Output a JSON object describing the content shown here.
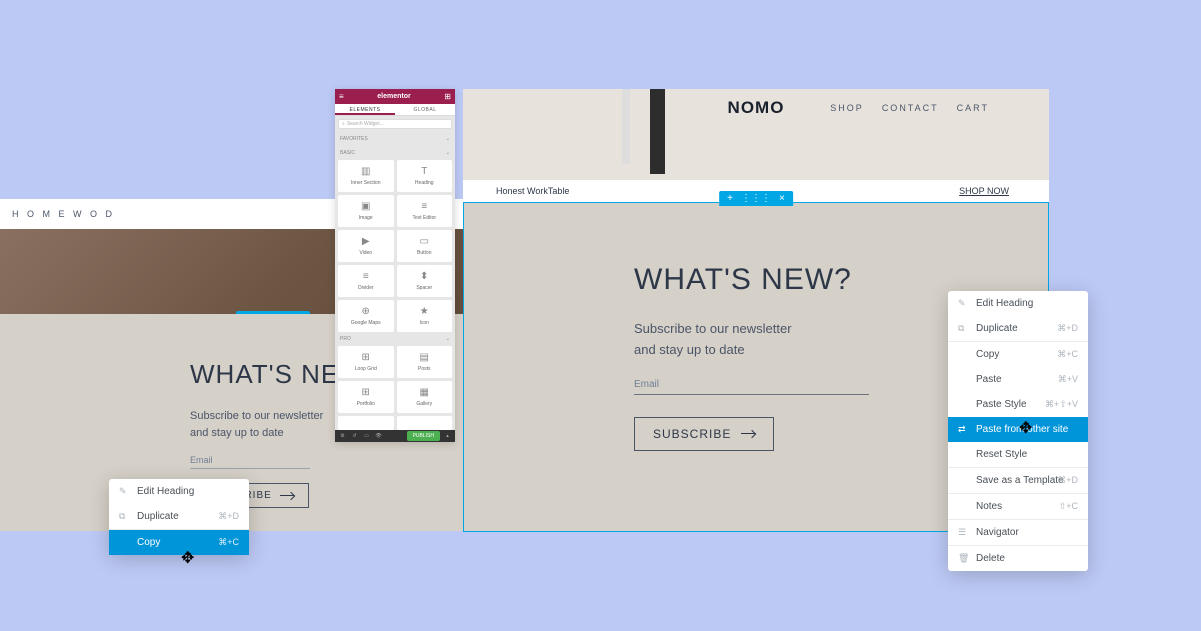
{
  "site_left": {
    "logo": "H O M E W O D",
    "heading": "WHAT'S NEW?",
    "sub_line1": "Subscribe to our newsletter",
    "sub_line2": "and stay up to date",
    "email_label": "Email",
    "subscribe_btn": "SUBSCRIBE"
  },
  "site_right": {
    "logo": "NOMO",
    "nav": {
      "shop": "SHOP",
      "contact": "CONTACT",
      "cart": "CART"
    },
    "product": "Honest WorkTable",
    "shop_now": "SHOP NOW",
    "heading": "WHAT'S NEW?",
    "sub_line1": "Subscribe to our newsletter",
    "sub_line2": "and stay up to date",
    "email_label": "Email",
    "subscribe_btn": "SUBSCRIBE"
  },
  "elementor": {
    "brand": "elementor",
    "tabs": {
      "elements": "ELEMENTS",
      "global": "GLOBAL"
    },
    "search_placeholder": "Search Widget...",
    "cat_favorites": "FAVORITES",
    "cat_basic": "BASIC",
    "cat_pro": "PRO",
    "widgets": {
      "inner_section": "Inner Section",
      "heading": "Heading",
      "image": "Image",
      "text_editor": "Text Editor",
      "video": "Video",
      "button": "Button",
      "divider": "Divider",
      "spacer": "Spacer",
      "google_maps": "Google Maps",
      "icon": "Icon",
      "loop_grid": "Loop Grid",
      "posts": "Posts",
      "portfolio": "Portfolio",
      "gallery": "Gallery"
    },
    "publish": "PUBLISH"
  },
  "ctx_left": {
    "edit_heading": "Edit Heading",
    "duplicate": "Duplicate",
    "duplicate_sc": "⌘+D",
    "copy": "Copy",
    "copy_sc": "⌘+C"
  },
  "ctx_right": {
    "edit_heading": "Edit Heading",
    "duplicate": "Duplicate",
    "duplicate_sc": "⌘+D",
    "copy": "Copy",
    "copy_sc": "⌘+C",
    "paste": "Paste",
    "paste_sc": "⌘+V",
    "paste_style": "Paste Style",
    "paste_style_sc": "⌘+⇧+V",
    "paste_other": "Paste from other site",
    "reset_style": "Reset Style",
    "save_template": "Save as a Template",
    "save_template_sc": "⌘+D",
    "notes": "Notes",
    "notes_sc": "⇧+C",
    "navigator": "Navigator",
    "delete": "Delete"
  }
}
